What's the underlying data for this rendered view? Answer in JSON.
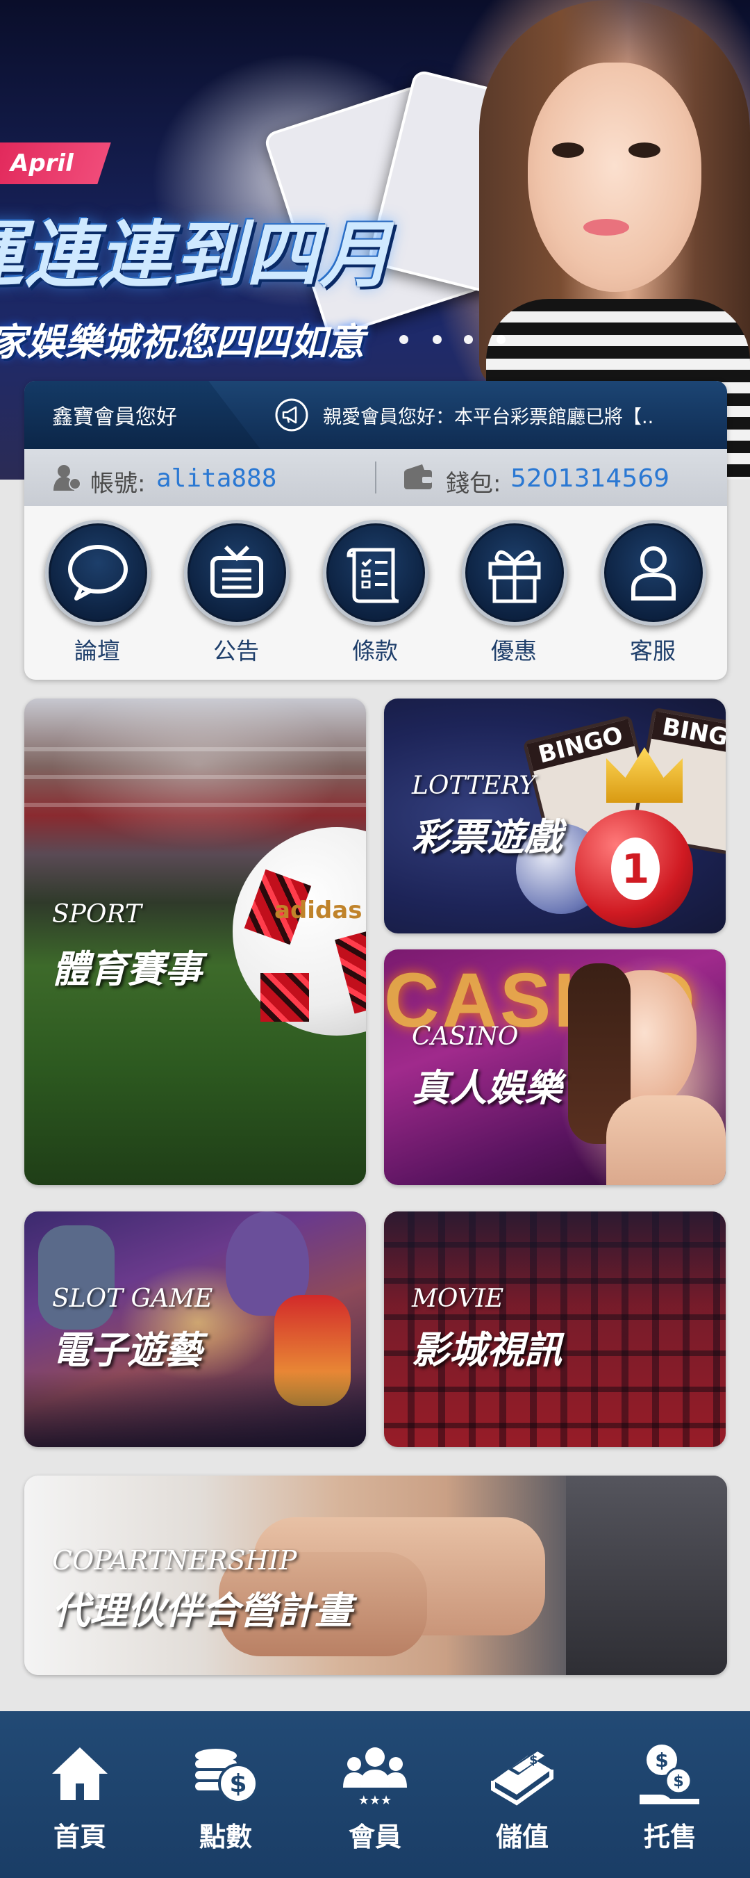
{
  "banner": {
    "tag": "April",
    "headline": "運連連到四月",
    "subline": "家娛樂城祝您四四如意"
  },
  "member": {
    "greeting": "鑫寶會員您好",
    "notice": "親愛會員您好：本平台彩票館廳已將【..",
    "account_label": "帳號:",
    "account_value": "alita888",
    "wallet_label": "錢包:",
    "wallet_value": "5201314569"
  },
  "quick_links": [
    {
      "label": "論壇",
      "icon": "chat-bubble-icon"
    },
    {
      "label": "公告",
      "icon": "tv-icon"
    },
    {
      "label": "條款",
      "icon": "scroll-checklist-icon"
    },
    {
      "label": "優惠",
      "icon": "gift-box-icon"
    },
    {
      "label": "客服",
      "icon": "person-icon"
    }
  ],
  "tiles": {
    "sport": {
      "en": "SPORT",
      "zh": "體育賽事",
      "ball_brand": "adidas"
    },
    "lottery": {
      "en": "LOTTERY",
      "zh": "彩票遊戲",
      "ball_number": "1",
      "card_text": "BINGO"
    },
    "casino": {
      "en": "CASINO",
      "zh": "真人娛樂",
      "sign_text": "CASINO"
    },
    "slot": {
      "en": "SLOT GAME",
      "zh": "電子遊藝"
    },
    "movie": {
      "en": "MOVIE",
      "zh": "影城視訊"
    },
    "partner": {
      "en": "COPARTNERSHIP",
      "zh": "代理伙伴合營計畫"
    }
  },
  "nav": [
    {
      "label": "首頁",
      "icon": "home-icon"
    },
    {
      "label": "點數",
      "icon": "coins-dollar-icon"
    },
    {
      "label": "會員",
      "icon": "members-icon"
    },
    {
      "label": "儲值",
      "icon": "cash-deposit-icon"
    },
    {
      "label": "托售",
      "icon": "money-bag-hand-icon"
    }
  ],
  "colors": {
    "nav_bg": "#1f4670",
    "link_blue": "#2a78d3",
    "header_navy": "#0f2c52"
  }
}
